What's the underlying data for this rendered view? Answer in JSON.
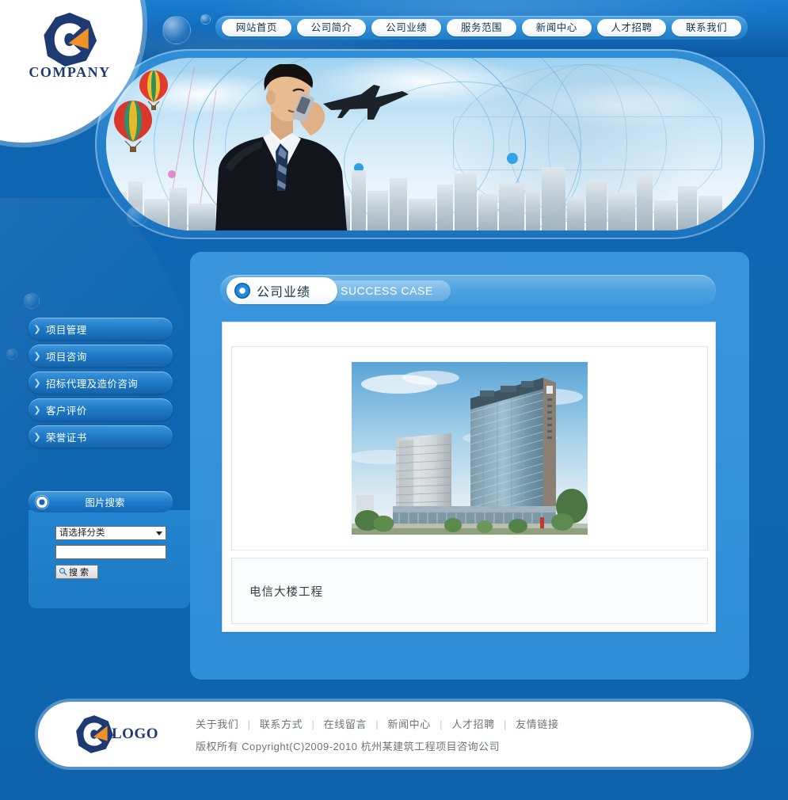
{
  "brand": {
    "name": "COMPANY",
    "logo_icon": "hexagon-c-logo",
    "footer_word": "LOGO",
    "navy": "#1d3a73",
    "orange": "#ef9226"
  },
  "nav": {
    "items": [
      {
        "label": "网站首页"
      },
      {
        "label": "公司简介"
      },
      {
        "label": "公司业绩"
      },
      {
        "label": "服务范围"
      },
      {
        "label": "新闻中心"
      },
      {
        "label": "人才招聘"
      },
      {
        "label": "联系我们"
      }
    ]
  },
  "banner": {
    "alt": "businessman-on-phone-city-skyline-banner"
  },
  "sidebar": {
    "menu": [
      {
        "label": "项目管理",
        "icon": "chevron-right-icon"
      },
      {
        "label": "项目咨询",
        "icon": "chevron-right-icon"
      },
      {
        "label": "招标代理及造价咨询",
        "icon": "chevron-right-icon"
      },
      {
        "label": "客户评价",
        "icon": "chevron-right-icon"
      },
      {
        "label": "荣誉证书",
        "icon": "chevron-right-icon"
      }
    ],
    "search": {
      "title": "图片搜索",
      "title_icon": "circle-dot-icon",
      "category_selected": "请选择分类",
      "keyword_value": "",
      "keyword_placeholder": "",
      "button_label": "搜 索",
      "button_icon": "magnifier-icon"
    }
  },
  "content": {
    "header": {
      "title_cn": "公司业绩",
      "title_en": "SUCCESS CASE",
      "icon": "circle-dot-icon"
    },
    "item": {
      "image_alt": "telecom-tower-building-rendering",
      "caption": "电信大楼工程"
    }
  },
  "footer": {
    "links": [
      {
        "label": "关于我们"
      },
      {
        "label": "联系方式"
      },
      {
        "label": "在线留言"
      },
      {
        "label": "新闻中心"
      },
      {
        "label": "人才招聘"
      },
      {
        "label": "友情链接"
      }
    ],
    "separator": "|",
    "copyright": "版权所有  Copyright(C)2009-2010 杭州某建筑工程项目咨询公司"
  },
  "theme": {
    "page_bg": "#0d66b3",
    "panel_bg": "#3492db",
    "header_bg": "#1572c4",
    "menu_bg": "#1f7bc8",
    "card_bg": "#ffffff"
  }
}
